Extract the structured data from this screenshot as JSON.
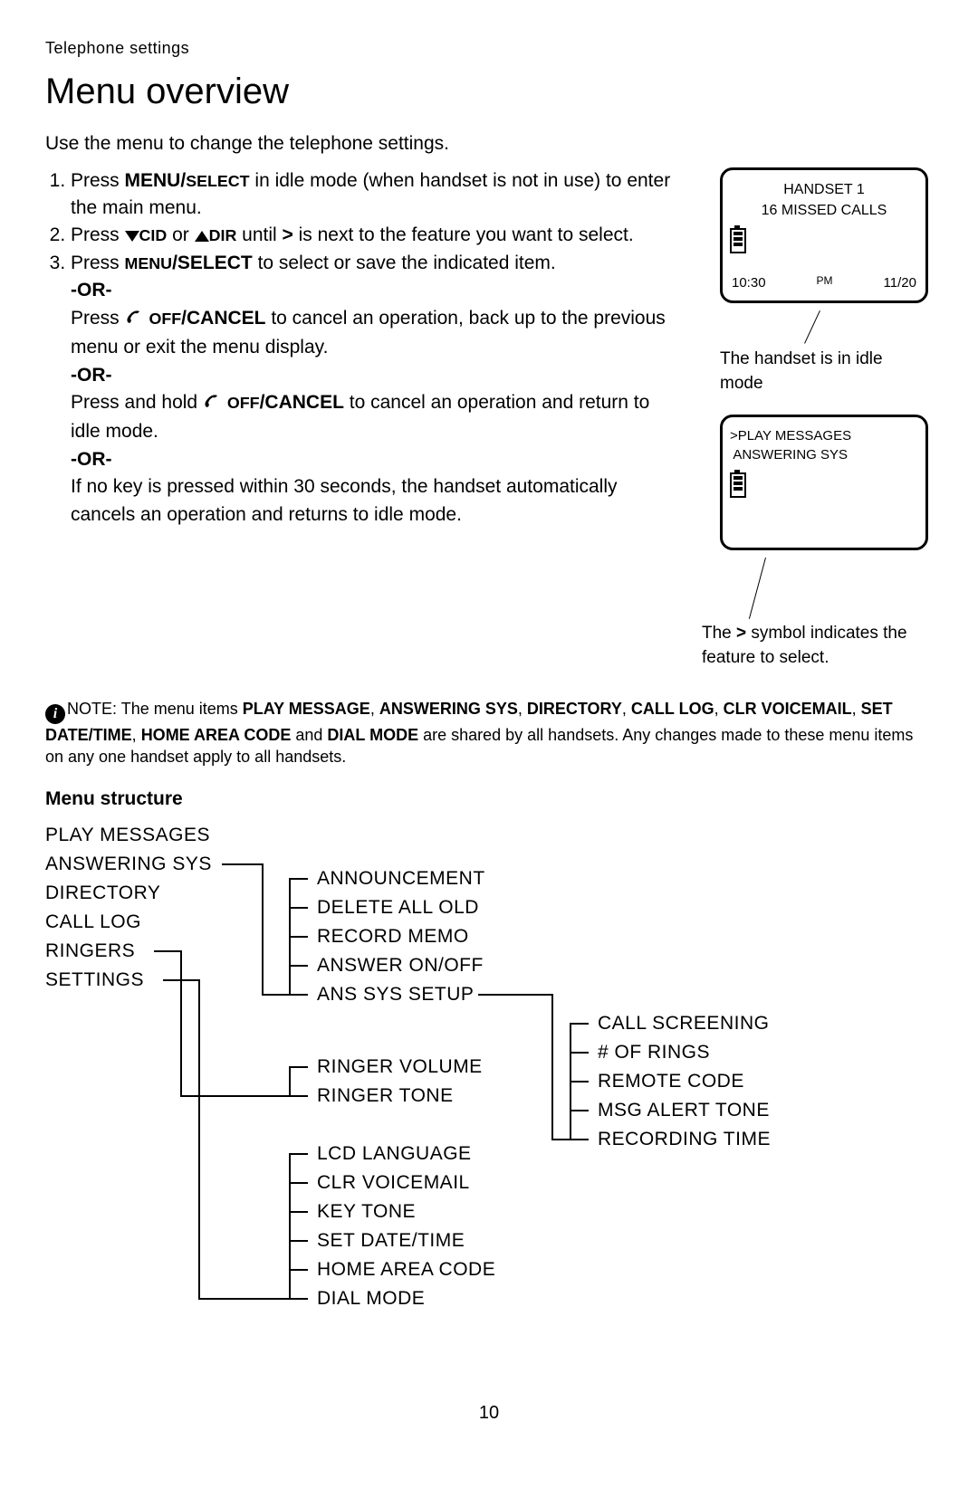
{
  "header_label": "Telephone settings",
  "title": "Menu overview",
  "intro": "Use the menu to change the telephone settings.",
  "steps": {
    "s1a": "Press ",
    "s1b": "MENU/",
    "s1c": "SELECT",
    "s1d": " in idle mode (when handset is not in use) to enter the main menu.",
    "s2a": "Press ",
    "s2b": "CID",
    "s2c": " or ",
    "s2d": "DIR",
    "s2e": " until ",
    "s2f": ">",
    "s2g": " is next to the feature you want to select.",
    "s3a": "Press ",
    "s3b": "MENU",
    "s3c": "/SELECT",
    "s3d": " to select or save the indicated item.",
    "or": "-OR-",
    "s3e": "Press ",
    "s3f": " OFF",
    "s3g": "/CANCEL",
    "s3h": " to cancel an operation, back up to the previous menu or exit the menu display.",
    "s3i": "Press and hold ",
    "s3j": " OFF",
    "s3k": "/CANCEL",
    "s3l": " to cancel an operation and return to idle mode.",
    "s3m": "If no key is pressed within 30 seconds, the handset automatically cancels an operation and returns to idle mode."
  },
  "note": {
    "prefix": "NOTE:",
    "t1": "The menu items ",
    "m1": "PLAY MESSAGE",
    "m2": "ANSWERING SYS",
    "m3": "DIRECTORY",
    "m4": "CALL LOG",
    "m5": "CLR VOICEMAIL",
    "m6": "SET DATE/TIME",
    "m7": "HOME AREA CODE",
    "m8": "DIAL MODE",
    "sep": ", ",
    "and": " and ",
    "tail": " are shared by all handsets. Any changes made to these menu items on any one handset apply to all handsets."
  },
  "lcd1": {
    "line1": "HANDSET 1",
    "line2": "16 MISSED CALLS",
    "time": "10:30",
    "ampm": "PM",
    "date": "11/20"
  },
  "caption1": "The handset is in idle mode",
  "lcd2": {
    "line1": ">PLAY MESSAGES",
    "line2": " ANSWERING SYS"
  },
  "caption2a": "The ",
  "caption2b": ">",
  "caption2c": " symbol indicates the feature to select.",
  "menu_structure_title": "Menu structure",
  "menu": {
    "col1": [
      "PLAY MESSAGES",
      "ANSWERING SYS",
      "DIRECTORY",
      "CALL LOG",
      "RINGERS",
      "SETTINGS"
    ],
    "col2a": [
      "ANNOUNCEMENT",
      "DELETE ALL OLD",
      "RECORD MEMO",
      "ANSWER ON/OFF",
      "ANS SYS SETUP"
    ],
    "col2b": [
      "RINGER VOLUME",
      "RINGER TONE"
    ],
    "col2c": [
      "LCD LANGUAGE",
      "CLR VOICEMAIL",
      "KEY TONE",
      "SET DATE/TIME",
      "HOME AREA CODE",
      "DIAL MODE"
    ],
    "col3": [
      "CALL SCREENING",
      "# OF RINGS",
      "REMOTE CODE",
      "MSG ALERT TONE",
      "RECORDING TIME"
    ]
  },
  "page_number": "10"
}
